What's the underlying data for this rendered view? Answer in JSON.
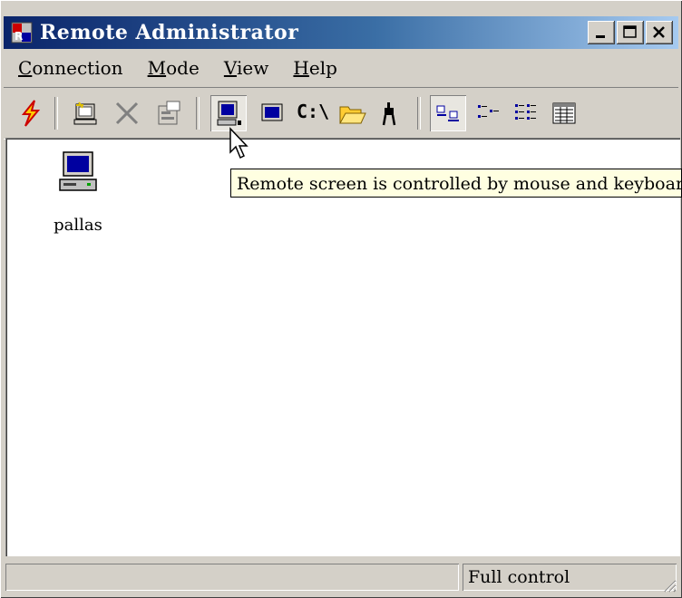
{
  "window": {
    "title": "Remote Administrator"
  },
  "menu": {
    "items": [
      {
        "accel": "C",
        "rest": "onnection"
      },
      {
        "accel": "M",
        "rest": "ode"
      },
      {
        "accel": "V",
        "rest": "iew"
      },
      {
        "accel": "H",
        "rest": "elp"
      }
    ]
  },
  "toolbar": {
    "text_button_label": "C:\\"
  },
  "hosts": [
    {
      "name": "pallas"
    }
  ],
  "tooltip": {
    "text": "Remote screen is controlled by mouse and keyboard"
  },
  "status": {
    "mode": "Full control"
  },
  "colors": {
    "titlebar_start": "#0a246a",
    "titlebar_end": "#a6caf0",
    "tooltip_bg": "#ffffe1",
    "chrome": "#d4d0c8"
  }
}
